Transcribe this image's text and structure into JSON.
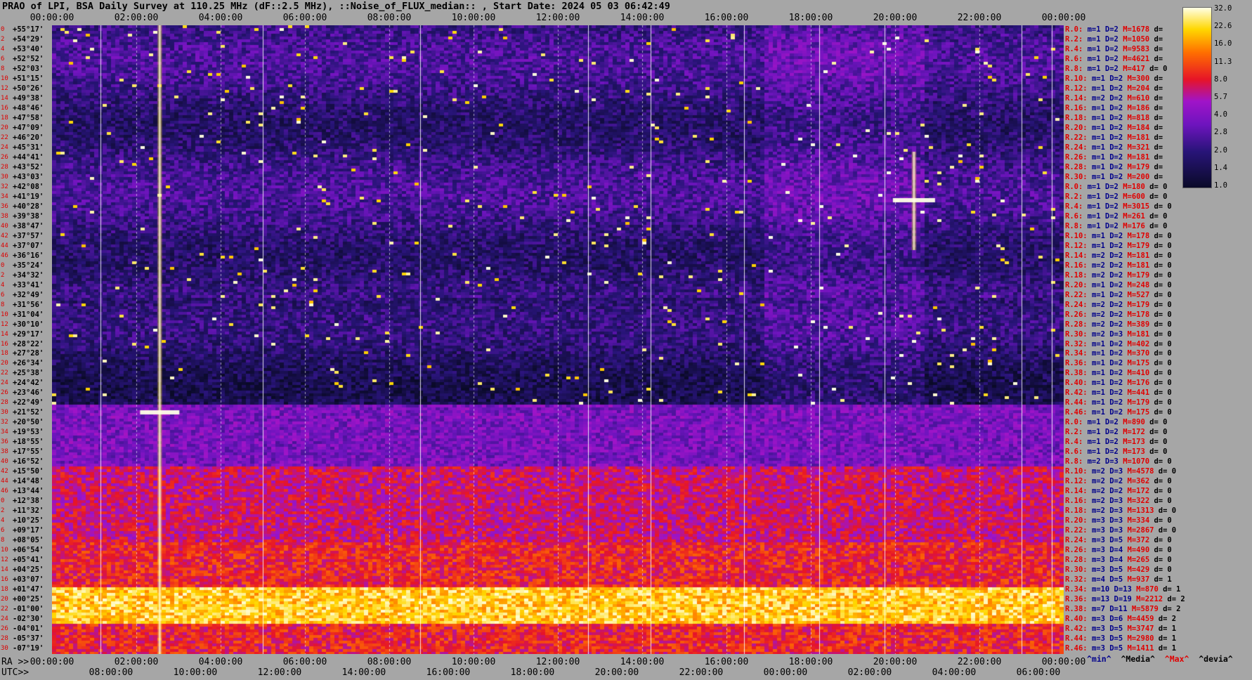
{
  "title": "PRAO of LPI, BSA Daily Survey at 110.25 MHz (dF::2.5 MHz), ::Noise_of_FLUX_median:: , Start Date: 2024 05 03 06:42:49",
  "chart_data": {
    "type": "heatmap",
    "top_axis_ticks": [
      "00:00:00",
      "02:00:00",
      "04:00:00",
      "06:00:00",
      "08:00:00",
      "10:00:00",
      "12:00:00",
      "14:00:00",
      "16:00:00",
      "18:00:00",
      "20:00:00",
      "22:00:00",
      "00:00:00"
    ],
    "ra_axis_label": "RA >>",
    "ra_ticks": [
      "00:00:00",
      "02:00:00",
      "04:00:00",
      "06:00:00",
      "08:00:00",
      "10:00:00",
      "12:00:00",
      "14:00:00",
      "16:00:00",
      "18:00:00",
      "20:00:00",
      "22:00:00",
      "00:00:00"
    ],
    "utc_axis_label": "UTC>>",
    "utc_ticks": [
      "08:00:00",
      "10:00:00",
      "12:00:00",
      "14:00:00",
      "16:00:00",
      "18:00:00",
      "20:00:00",
      "22:00:00",
      "00:00:00",
      "02:00:00",
      "04:00:00",
      "06:00:00"
    ],
    "declinations": [
      "+55°17'",
      "+54°29'",
      "+53°40'",
      "+52°52'",
      "+52°03'",
      "+51°15'",
      "+50°26'",
      "+49°38'",
      "+48°46'",
      "+47°58'",
      "+47°09'",
      "+46°20'",
      "+45°31'",
      "+44°41'",
      "+43°52'",
      "+43°03'",
      "+42°08'",
      "+41°19'",
      "+40°28'",
      "+39°38'",
      "+38°47'",
      "+37°57'",
      "+37°07'",
      "+36°16'",
      "+35°24'",
      "+34°32'",
      "+33°41'",
      "+32°49'",
      "+31°56'",
      "+31°04'",
      "+30°10'",
      "+29°17'",
      "+28°22'",
      "+27°28'",
      "+26°34'",
      "+25°38'",
      "+24°42'",
      "+23°46'",
      "+22°49'",
      "+21°52'",
      "+20°50'",
      "+19°53'",
      "+18°55'",
      "+17°55'",
      "+16°52'",
      "+15°50'",
      "+14°48'",
      "+13°44'",
      "+12°38'",
      "+11°32'",
      "+10°25'",
      "+09°17'",
      "+08°05'",
      "+06°54'",
      "+05°41'",
      "+04°25'",
      "+03°07'",
      "+01°47'",
      "+00°25'",
      "-01°00'",
      "-02°30'",
      "-04°01'",
      "-05°37'",
      "-07°19'"
    ],
    "colorbar": {
      "ticks": [
        "32.0",
        "22.6",
        "16.0",
        "11.3",
        "8.0",
        "5.7",
        "4.0",
        "2.8",
        "2.0",
        "1.4",
        "1.0"
      ],
      "range": [
        1.0,
        32.0
      ],
      "scale": "log"
    },
    "stats_legend": [
      "^min^",
      "^Media^",
      "^Max^",
      "^devia^"
    ],
    "stats_rows": [
      [
        "R.0:",
        "m=1",
        "D=2",
        "M=1678",
        "d="
      ],
      [
        "R.2:",
        "m=1",
        "D=2",
        "M=1050",
        "d="
      ],
      [
        "R.4:",
        "m=1",
        "D=2",
        "M=9583",
        "d="
      ],
      [
        "R.6:",
        "m=1",
        "D=2",
        "M=4621",
        "d="
      ],
      [
        "R.8:",
        "m=1",
        "D=2",
        "M=417",
        "d= 0"
      ],
      [
        "R.10:",
        "m=1",
        "D=2",
        "M=300",
        "d="
      ],
      [
        "R.12:",
        "m=1",
        "D=2",
        "M=204",
        "d="
      ],
      [
        "R.14:",
        "m=2",
        "D=2",
        "M=610",
        "d="
      ],
      [
        "R.16:",
        "m=1",
        "D=2",
        "M=186",
        "d="
      ],
      [
        "R.18:",
        "m=1",
        "D=2",
        "M=818",
        "d="
      ],
      [
        "R.20:",
        "m=1",
        "D=2",
        "M=184",
        "d="
      ],
      [
        "R.22:",
        "m=1",
        "D=2",
        "M=181",
        "d="
      ],
      [
        "R.24:",
        "m=1",
        "D=2",
        "M=321",
        "d="
      ],
      [
        "R.26:",
        "m=1",
        "D=2",
        "M=181",
        "d="
      ],
      [
        "R.28:",
        "m=1",
        "D=2",
        "M=179",
        "d="
      ],
      [
        "R.30:",
        "m=1",
        "D=2",
        "M=200",
        "d="
      ],
      [
        "R.0:",
        "m=1",
        "D=2",
        "M=180",
        "d= 0"
      ],
      [
        "R.2:",
        "m=1",
        "D=2",
        "M=600",
        "d= 0"
      ],
      [
        "R.4:",
        "m=1",
        "D=2",
        "M=3015",
        "d= 0"
      ],
      [
        "R.6:",
        "m=1",
        "D=2",
        "M=261",
        "d= 0"
      ],
      [
        "R.8:",
        "m=1",
        "D=2",
        "M=176",
        "d= 0"
      ],
      [
        "R.10:",
        "m=1",
        "D=2",
        "M=178",
        "d= 0"
      ],
      [
        "R.12:",
        "m=1",
        "D=2",
        "M=179",
        "d= 0"
      ],
      [
        "R.14:",
        "m=2",
        "D=2",
        "M=181",
        "d= 0"
      ],
      [
        "R.16:",
        "m=2",
        "D=2",
        "M=181",
        "d= 0"
      ],
      [
        "R.18:",
        "m=2",
        "D=2",
        "M=179",
        "d= 0"
      ],
      [
        "R.20:",
        "m=1",
        "D=2",
        "M=248",
        "d= 0"
      ],
      [
        "R.22:",
        "m=1",
        "D=2",
        "M=527",
        "d= 0"
      ],
      [
        "R.24:",
        "m=2",
        "D=2",
        "M=179",
        "d= 0"
      ],
      [
        "R.26:",
        "m=2",
        "D=2",
        "M=178",
        "d= 0"
      ],
      [
        "R.28:",
        "m=2",
        "D=2",
        "M=389",
        "d= 0"
      ],
      [
        "R.30:",
        "m=2",
        "D=3",
        "M=181",
        "d= 0"
      ],
      [
        "R.32:",
        "m=1",
        "D=2",
        "M=402",
        "d= 0"
      ],
      [
        "R.34:",
        "m=1",
        "D=2",
        "M=370",
        "d= 0"
      ],
      [
        "R.36:",
        "m=1",
        "D=2",
        "M=175",
        "d= 0"
      ],
      [
        "R.38:",
        "m=1",
        "D=2",
        "M=410",
        "d= 0"
      ],
      [
        "R.40:",
        "m=1",
        "D=2",
        "M=176",
        "d= 0"
      ],
      [
        "R.42:",
        "m=1",
        "D=2",
        "M=441",
        "d= 0"
      ],
      [
        "R.44:",
        "m=1",
        "D=2",
        "M=179",
        "d= 0"
      ],
      [
        "R.46:",
        "m=1",
        "D=2",
        "M=175",
        "d= 0"
      ],
      [
        "R.0:",
        "m=1",
        "D=2",
        "M=890",
        "d= 0"
      ],
      [
        "R.2:",
        "m=1",
        "D=2",
        "M=172",
        "d= 0"
      ],
      [
        "R.4:",
        "m=1",
        "D=2",
        "M=173",
        "d= 0"
      ],
      [
        "R.6:",
        "m=1",
        "D=2",
        "M=173",
        "d= 0"
      ],
      [
        "R.8:",
        "m=2",
        "D=3",
        "M=1070",
        "d= 0"
      ],
      [
        "R.10:",
        "m=2",
        "D=3",
        "M=4578",
        "d= 0"
      ],
      [
        "R.12:",
        "m=2",
        "D=2",
        "M=362",
        "d= 0"
      ],
      [
        "R.14:",
        "m=2",
        "D=2",
        "M=172",
        "d= 0"
      ],
      [
        "R.16:",
        "m=2",
        "D=3",
        "M=322",
        "d= 0"
      ],
      [
        "R.18:",
        "m=2",
        "D=3",
        "M=1313",
        "d= 0"
      ],
      [
        "R.20:",
        "m=3",
        "D=3",
        "M=334",
        "d= 0"
      ],
      [
        "R.22:",
        "m=3",
        "D=3",
        "M=2867",
        "d= 0"
      ],
      [
        "R.24:",
        "m=3",
        "D=5",
        "M=372",
        "d= 0"
      ],
      [
        "R.26:",
        "m=3",
        "D=4",
        "M=490",
        "d= 0"
      ],
      [
        "R.28:",
        "m=3",
        "D=4",
        "M=265",
        "d= 0"
      ],
      [
        "R.30:",
        "m=3",
        "D=5",
        "M=429",
        "d= 0"
      ],
      [
        "R.32:",
        "m=4",
        "D=5",
        "M=937",
        "d= 1"
      ],
      [
        "R.34:",
        "m=10",
        "D=13",
        "M=870",
        "d= 1"
      ],
      [
        "R.36:",
        "m=13",
        "D=19",
        "M=2212",
        "d= 2"
      ],
      [
        "R.38:",
        "m=7",
        "D=11",
        "M=5879",
        "d= 2"
      ],
      [
        "R.40:",
        "m=3",
        "D=6",
        "M=4459",
        "d= 2"
      ],
      [
        "R.42:",
        "m=3",
        "D=5",
        "M=3747",
        "d= 1"
      ],
      [
        "R.44:",
        "m=3",
        "D=5",
        "M=2980",
        "d= 1"
      ],
      [
        "R.46:",
        "m=3",
        "D=5",
        "M=1411",
        "d= 1"
      ]
    ]
  }
}
